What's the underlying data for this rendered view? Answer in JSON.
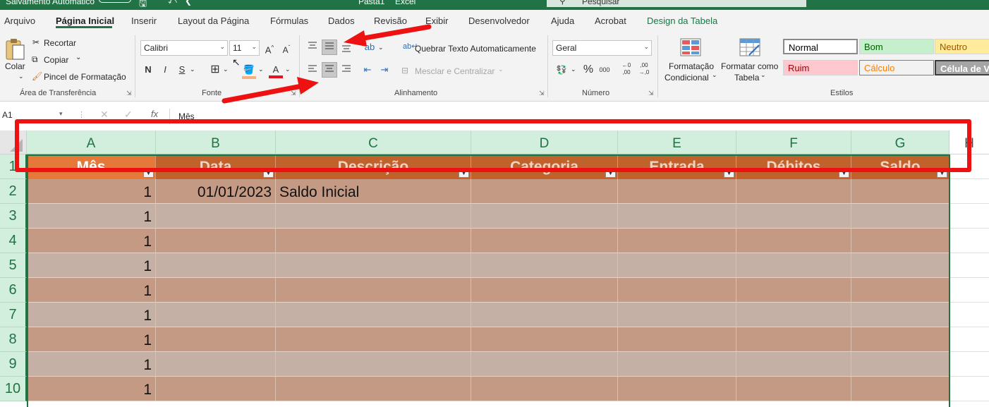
{
  "titlebar": {
    "autosave": "Salvamento Automático",
    "filename": "Pasta1",
    "app": "Excel",
    "search_placeholder": "Pesquisar"
  },
  "menu": {
    "items": [
      "Arquivo",
      "Página Inicial",
      "Inserir",
      "Layout da Página",
      "Fórmulas",
      "Dados",
      "Revisão",
      "Exibir",
      "Desenvolvedor",
      "Ajuda",
      "Acrobat",
      "Design da Tabela"
    ]
  },
  "ribbon": {
    "clipboard": {
      "paste": "Colar",
      "cut": "Recortar",
      "copy": "Copiar",
      "format_painter": "Pincel de Formatação",
      "group": "Área de Transferência"
    },
    "font": {
      "name": "Calibri",
      "size": "11",
      "bold": "N",
      "italic": "I",
      "underline": "S",
      "group": "Fonte"
    },
    "alignment": {
      "wrap_text": "Quebrar Texto Automaticamente",
      "merge_center": "Mesclar e Centralizar",
      "group": "Alinhamento"
    },
    "number": {
      "format": "Geral",
      "group": "Número"
    },
    "styles": {
      "conditional": [
        "Formatação",
        "Condicional"
      ],
      "as_table": [
        "Formatar como",
        "Tabela"
      ],
      "cells": [
        {
          "label": "Normal",
          "bg": "#ffffff",
          "fg": "#000000"
        },
        {
          "label": "Bom",
          "bg": "#c6efce",
          "fg": "#006100"
        },
        {
          "label": "Neutro",
          "bg": "#ffeb9c",
          "fg": "#9c5700"
        },
        {
          "label": "Ruim",
          "bg": "#ffc7ce",
          "fg": "#9c0006"
        },
        {
          "label": "Cálculo",
          "bg": "#f2f2f2",
          "fg": "#fa7d00"
        },
        {
          "label": "Célula de Ve",
          "bg": "#a5a5a5",
          "fg": "#ffffff"
        }
      ],
      "group": "Estilos"
    }
  },
  "formula_bar": {
    "name_box": "A1",
    "content": "Mês"
  },
  "sheet": {
    "columns": [
      "A",
      "B",
      "C",
      "D",
      "E",
      "F",
      "G",
      "H"
    ],
    "row_numbers": [
      "1",
      "2",
      "3",
      "4",
      "5",
      "6",
      "7",
      "8",
      "9",
      "10"
    ],
    "table_headers": [
      "Mês",
      "Data",
      "Descrição",
      "Categoria",
      "Entrada",
      "Débitos",
      "Saldo"
    ],
    "rows": [
      [
        "1",
        "01/01/2023",
        "Saldo Inicial",
        "",
        "",
        "",
        ""
      ],
      [
        "1",
        "",
        "",
        "",
        "",
        "",
        ""
      ],
      [
        "1",
        "",
        "",
        "",
        "",
        "",
        ""
      ],
      [
        "1",
        "",
        "",
        "",
        "",
        "",
        ""
      ],
      [
        "1",
        "",
        "",
        "",
        "",
        "",
        ""
      ],
      [
        "1",
        "",
        "",
        "",
        "",
        "",
        ""
      ],
      [
        "1",
        "",
        "",
        "",
        "",
        "",
        ""
      ],
      [
        "1",
        "",
        "",
        "",
        "",
        "",
        ""
      ],
      [
        "1",
        "",
        "",
        "",
        "",
        "",
        ""
      ]
    ],
    "band_colors": [
      "#c49a84",
      "#c5b0a5"
    ],
    "header_color": "#c0622b",
    "mes_header_color": "#e5793a"
  },
  "annotation": {
    "color": "#ee1111"
  }
}
